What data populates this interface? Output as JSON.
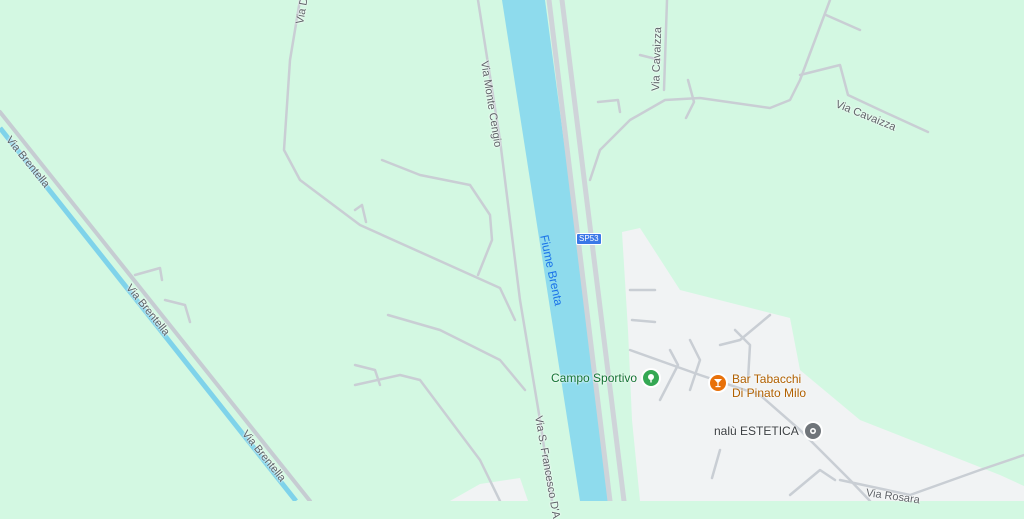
{
  "colors": {
    "land": "#d3f8e2",
    "urban": "#f1f3f4",
    "river": "#8edbed",
    "road": "#ffffff",
    "road_edge": "#c6ccd2",
    "highway": "#dadce0",
    "canal": "#7fd3ea",
    "poi_green": "#34a853",
    "poi_orange": "#e8710a",
    "poi_gray": "#70757a"
  },
  "roads": {
    "via_brentella_1": "Via Brentella",
    "via_brentella_2": "Via Brentella",
    "via_brentella_3": "Via Brentella",
    "via_monte_cengio": "Via Monte Cengio",
    "via_s_francesco": "Via S. Francesco D'A",
    "via_cavaizza_1": "Via Cavaizza",
    "via_cavaizza_2": "Via Cavaizza",
    "via_rosara": "Via Rosara",
    "via_de": "Via De",
    "sp53": "SP53"
  },
  "river": {
    "name": "Fiume Brenta"
  },
  "pois": {
    "campo_sportivo": {
      "name": "Campo Sportivo",
      "icon": "park-icon"
    },
    "bar_tabacchi": {
      "line1": "Bar Tabacchi",
      "line2": "Di Pinato Milo",
      "icon": "cocktail-icon"
    },
    "nalu_estetica": {
      "name": "nalù ESTETICA",
      "icon": "place-icon"
    }
  }
}
